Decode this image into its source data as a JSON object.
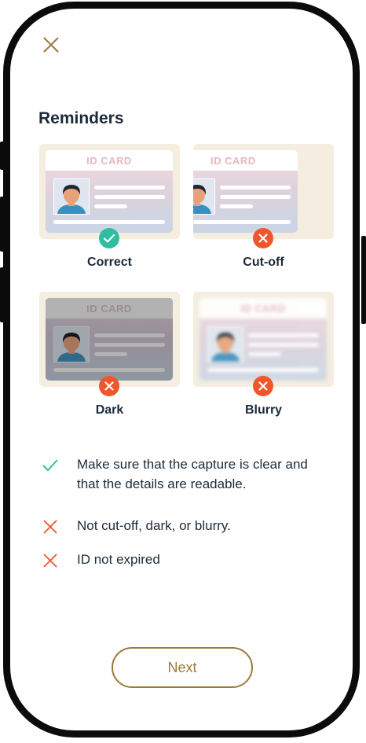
{
  "screen": {
    "title": "Reminders",
    "close_icon": "close-x-icon"
  },
  "cards": [
    {
      "id_label": "ID CARD",
      "caption": "Correct",
      "status": "check-icon",
      "status_color": "#2fbfa0"
    },
    {
      "id_label": "ID CARD",
      "caption": "Cut-off",
      "status": "x-icon",
      "status_color": "#f0562b"
    },
    {
      "id_label": "ID CARD",
      "caption": "Dark",
      "status": "x-icon",
      "status_color": "#f0562b"
    },
    {
      "id_label": "ID CARD",
      "caption": "Blurry",
      "status": "x-icon",
      "status_color": "#f0562b"
    }
  ],
  "rules": [
    {
      "icon": "check-icon",
      "text": "Make sure that the capture is clear and that the details are readable."
    },
    {
      "icon": "x-icon",
      "text": "Not cut-off, dark, or blurry."
    },
    {
      "icon": "x-icon",
      "text": "ID not expired"
    }
  ],
  "actions": {
    "next_label": "Next"
  },
  "colors": {
    "accent": "#9c7a3c",
    "success": "#2fbfa0",
    "error": "#f0562b",
    "text": "#1c2b3a"
  }
}
